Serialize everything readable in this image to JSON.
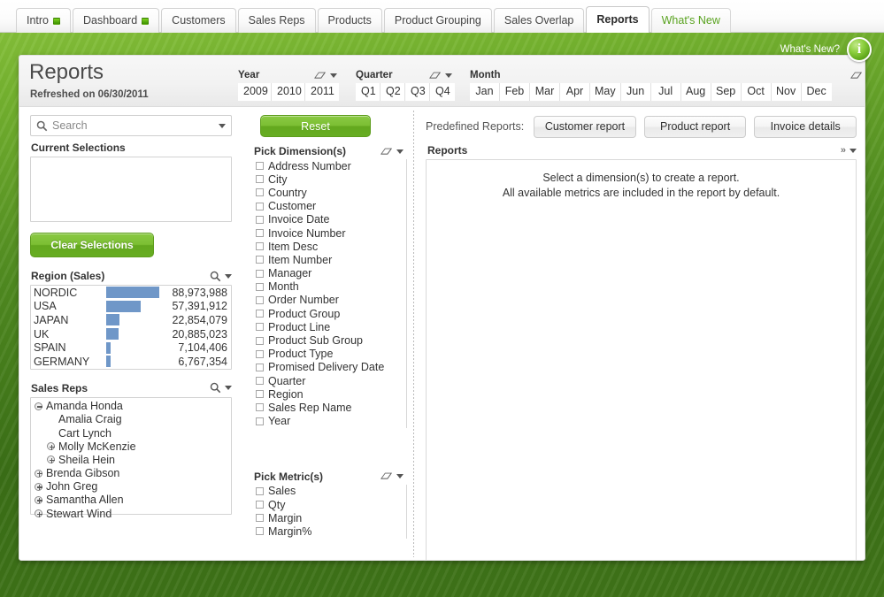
{
  "tabs": [
    {
      "label": "Intro",
      "dot": true,
      "active": false
    },
    {
      "label": "Dashboard",
      "dot": true,
      "active": false
    },
    {
      "label": "Customers",
      "dot": false,
      "active": false
    },
    {
      "label": "Sales Reps",
      "dot": false,
      "active": false
    },
    {
      "label": "Products",
      "dot": false,
      "active": false
    },
    {
      "label": "Product Grouping",
      "dot": false,
      "active": false
    },
    {
      "label": "Sales Overlap",
      "dot": false,
      "active": false
    },
    {
      "label": "Reports",
      "dot": false,
      "active": true
    },
    {
      "label": "What's New",
      "dot": false,
      "active": false,
      "style": "whatsnew"
    }
  ],
  "whats_new": {
    "label": "What's New?",
    "icon": "info-icon",
    "glyph": "i"
  },
  "header": {
    "title": "Reports",
    "refreshed": "Refreshed on  06/30/2011"
  },
  "filters": [
    {
      "name": "Year",
      "values": [
        "2009",
        "2010",
        "2011"
      ],
      "eraser_icon": "eraser-icon",
      "caret_icon": "chevron-down-icon"
    },
    {
      "name": "Quarter",
      "values": [
        "Q1",
        "Q2",
        "Q3",
        "Q4"
      ],
      "eraser_icon": "eraser-icon",
      "caret_icon": "chevron-down-icon"
    },
    {
      "name": "Month",
      "values": [
        "Jan",
        "Feb",
        "Mar",
        "Apr",
        "May",
        "Jun",
        "Jul",
        "Aug",
        "Sep",
        "Oct",
        "Nov",
        "Dec"
      ],
      "eraser_icon": "eraser-icon",
      "caret_icon": "chevron-down-icon"
    }
  ],
  "left": {
    "search": {
      "placeholder": "Search",
      "value": "",
      "icon": "search-icon",
      "caret_icon": "chevron-down-icon"
    },
    "current_selections": {
      "title": "Current Selections",
      "items": []
    },
    "clear_button": "Clear Selections",
    "region": {
      "title": "Region (Sales)",
      "search_icon": "magnifier-icon",
      "caret_icon": "chevron-down-icon"
    },
    "sales_reps": {
      "title": "Sales Reps",
      "search_icon": "magnifier-icon",
      "caret_icon": "chevron-down-icon",
      "items": [
        {
          "label": "Amanda Honda",
          "level": 0,
          "toggle": "minus"
        },
        {
          "label": "Amalia Craig",
          "level": 1,
          "toggle": "none"
        },
        {
          "label": "Cart Lynch",
          "level": 1,
          "toggle": "none"
        },
        {
          "label": "Molly McKenzie",
          "level": 1,
          "toggle": "plus"
        },
        {
          "label": "Sheila Hein",
          "level": 1,
          "toggle": "plus"
        },
        {
          "label": "Brenda Gibson",
          "level": 0,
          "toggle": "plus"
        },
        {
          "label": "John Greg",
          "level": 0,
          "toggle": "plus"
        },
        {
          "label": "Samantha Allen",
          "level": 0,
          "toggle": "plus"
        },
        {
          "label": "Stewart Wind",
          "level": 0,
          "toggle": "plus"
        }
      ]
    }
  },
  "middle": {
    "reset_button": "Reset",
    "dimensions": {
      "title": "Pick Dimension(s)",
      "eraser_icon": "eraser-icon",
      "caret_icon": "chevron-down-icon",
      "items": [
        {
          "label": "Address Number",
          "checked": false
        },
        {
          "label": "City",
          "checked": false
        },
        {
          "label": "Country",
          "checked": false
        },
        {
          "label": "Customer",
          "checked": false
        },
        {
          "label": "Invoice Date",
          "checked": false
        },
        {
          "label": "Invoice Number",
          "checked": false
        },
        {
          "label": "Item Desc",
          "checked": false
        },
        {
          "label": "Item Number",
          "checked": false
        },
        {
          "label": "Manager",
          "checked": false
        },
        {
          "label": "Month",
          "checked": false
        },
        {
          "label": "Order Number",
          "checked": false
        },
        {
          "label": "Product Group",
          "checked": false
        },
        {
          "label": "Product Line",
          "checked": false
        },
        {
          "label": "Product Sub Group",
          "checked": false
        },
        {
          "label": "Product Type",
          "checked": false
        },
        {
          "label": "Promised Delivery Date",
          "checked": false
        },
        {
          "label": "Quarter",
          "checked": false
        },
        {
          "label": "Region",
          "checked": false
        },
        {
          "label": "Sales Rep Name",
          "checked": false
        },
        {
          "label": "Year",
          "checked": false
        }
      ]
    },
    "metrics": {
      "title": "Pick Metric(s)",
      "eraser_icon": "eraser-icon",
      "caret_icon": "chevron-down-icon",
      "items": [
        {
          "label": "Sales",
          "checked": false
        },
        {
          "label": "Qty",
          "checked": false
        },
        {
          "label": "Margin",
          "checked": false
        },
        {
          "label": "Margin%",
          "checked": false
        }
      ]
    }
  },
  "right": {
    "predefined_label": "Predefined Reports:",
    "predefined_buttons": [
      "Customer report",
      "Product report",
      "Invoice details"
    ],
    "reports_title": "Reports",
    "expand_icon": "chevron-double-right-icon",
    "caret_icon": "chevron-down-icon",
    "empty_message_line1": "Select a dimension(s) to create a report.",
    "empty_message_line2": "All available metrics are included in the report by default."
  },
  "colors": {
    "accent_green": "#7cbf33",
    "background_green": "#4f8a20",
    "bar_blue": "#6f97c8",
    "tab_active_bg": "#ffffff",
    "whats_new_text": "#5aa320"
  },
  "chart_data": {
    "type": "bar",
    "title": "Region (Sales)",
    "orientation": "horizontal",
    "categories": [
      "NORDIC",
      "USA",
      "JAPAN",
      "UK",
      "SPAIN",
      "GERMANY"
    ],
    "values": [
      88973988,
      57391912,
      22854079,
      20885023,
      7104406,
      6767354
    ],
    "value_labels": [
      "88,973,988",
      "57,391,912",
      "22,854,079",
      "20,885,023",
      "7,104,406",
      "6,767,354"
    ],
    "xlabel": "",
    "ylabel": "",
    "xlim": [
      0,
      88973988
    ],
    "grid": false,
    "legend": false,
    "series_color": "#6f97c8"
  }
}
